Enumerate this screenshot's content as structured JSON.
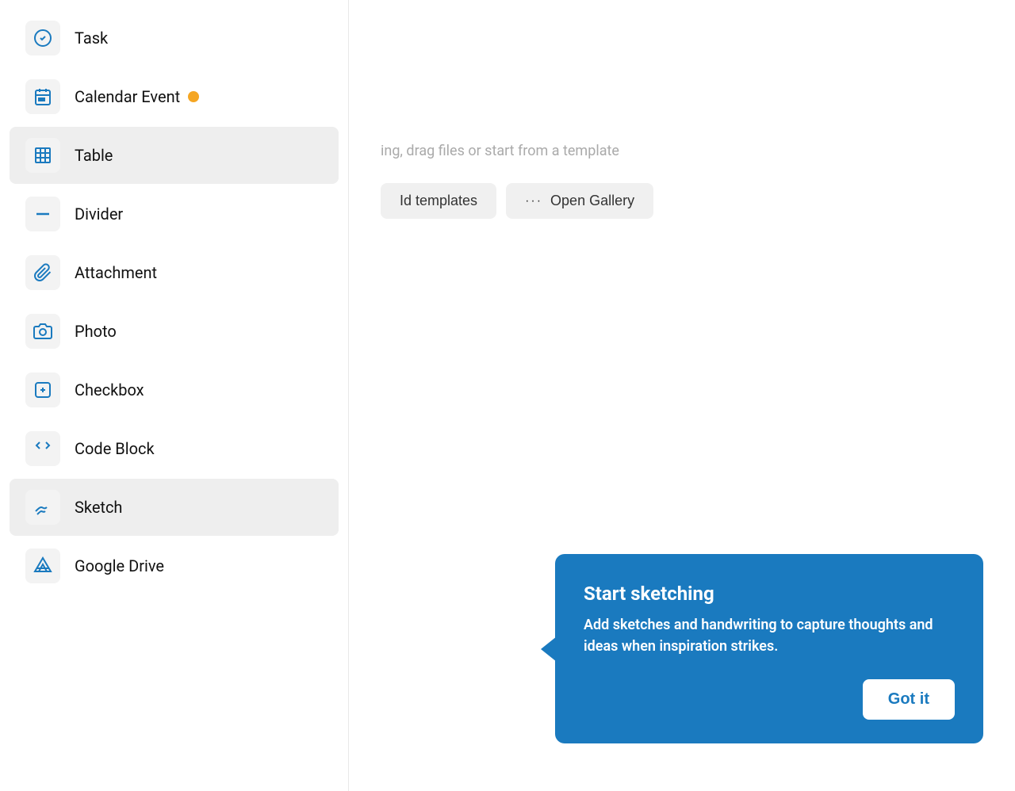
{
  "menu": {
    "items": [
      {
        "id": "task",
        "label": "Task",
        "icon": "task-icon",
        "active": false,
        "notification": false
      },
      {
        "id": "calendar-event",
        "label": "Calendar Event",
        "icon": "calendar-icon",
        "active": false,
        "notification": true
      },
      {
        "id": "table",
        "label": "Table",
        "icon": "table-icon",
        "active": true,
        "notification": false
      },
      {
        "id": "divider",
        "label": "Divider",
        "icon": "divider-icon",
        "active": false,
        "notification": false
      },
      {
        "id": "attachment",
        "label": "Attachment",
        "icon": "attachment-icon",
        "active": false,
        "notification": false
      },
      {
        "id": "photo",
        "label": "Photo",
        "icon": "photo-icon",
        "active": false,
        "notification": false
      },
      {
        "id": "checkbox",
        "label": "Checkbox",
        "icon": "checkbox-icon",
        "active": false,
        "notification": false
      },
      {
        "id": "code-block",
        "label": "Code Block",
        "icon": "code-block-icon",
        "active": false,
        "notification": false
      },
      {
        "id": "sketch",
        "label": "Sketch",
        "icon": "sketch-icon",
        "active": false,
        "notification": false
      },
      {
        "id": "google-drive",
        "label": "Google Drive",
        "icon": "google-drive-icon",
        "active": false,
        "notification": false
      }
    ]
  },
  "content": {
    "hint_text": "ing, drag files or start from a template",
    "buttons": [
      {
        "id": "id-templates",
        "label": "Id templates",
        "icon": ""
      },
      {
        "id": "open-gallery",
        "label": "Open Gallery",
        "icon": "···"
      }
    ]
  },
  "tooltip": {
    "title": "Start sketching",
    "body": "Add sketches and handwriting to capture thoughts and ideas when inspiration strikes.",
    "got_it_label": "Got it"
  }
}
